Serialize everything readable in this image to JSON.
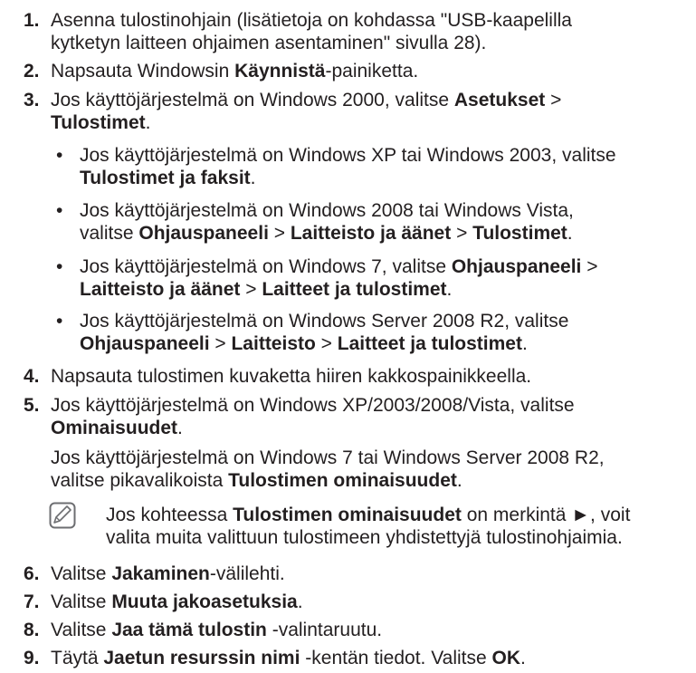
{
  "steps": [
    {
      "num": "1.",
      "l1": "Asenna tulostinohjain (lisätietoja on kohdassa \"USB-kaapelilla",
      "l2": "kytketyn laitteen ohjaimen asentaminen\" sivulla 28)."
    },
    {
      "num": "2.",
      "pre": "Napsauta Windowsin ",
      "b": "Käynnistä",
      "post": "-painiketta."
    },
    {
      "num": "3.",
      "pre": "Jos käyttöjärjestelmä on Windows 2000, valitse ",
      "b1": "Asetukset",
      "mid": " >",
      "b2": "Tulostimet",
      "post": "."
    },
    {
      "num": "4.",
      "text": "Napsauta tulostimen kuvaketta hiiren kakkospainikkeella."
    },
    {
      "num": "5.",
      "pre": "Jos käyttöjärjestelmä on Windows XP/2003/2008/Vista, valitse",
      "b": "Ominaisuudet",
      "post": "."
    },
    {
      "num": "6.",
      "pre": "Valitse ",
      "b": "Jakaminen",
      "post": "-välilehti."
    },
    {
      "num": "7.",
      "pre": "Valitse ",
      "b": "Muuta jakoasetuksia",
      "post": "."
    },
    {
      "num": "8.",
      "pre": "Valitse ",
      "b": "Jaa tämä tulostin",
      "post": " -valintaruutu."
    },
    {
      "num": "9.",
      "pre": "Täytä ",
      "b": "Jaetun resurssin nimi",
      "mid": " -kentän tiedot. Valitse ",
      "b2": "OK",
      "post": "."
    }
  ],
  "bullets": [
    {
      "dot": "•",
      "pre": "Jos käyttöjärjestelmä on Windows XP tai Windows 2003, valitse",
      "b1": "Tulostimet ja faksit",
      "post": "."
    },
    {
      "dot": "•",
      "pre": "Jos käyttöjärjestelmä on Windows 2008 tai Windows Vista,",
      "l2pre": "valitse ",
      "b1": "Ohjauspaneeli",
      "s1": " > ",
      "b2": "Laitteisto ja äänet",
      "s2": " > ",
      "b3": "Tulostimet",
      "post": "."
    },
    {
      "dot": "•",
      "pre": "Jos käyttöjärjestelmä on Windows 7, valitse ",
      "b1": "Ohjauspaneeli",
      "s1": " >",
      "b2": "Laitteisto ja äänet",
      "s2": " > ",
      "b3": "Laitteet ja tulostimet",
      "post": "."
    },
    {
      "dot": "•",
      "pre": "Jos käyttöjärjestelmä on Windows Server 2008 R2, valitse",
      "b1": "Ohjauspaneeli",
      "s1": " > ",
      "b2": "Laitteisto",
      "s2": " > ",
      "b3": "Laitteet ja tulostimet",
      "post": "."
    }
  ],
  "step5_extra": {
    "l1": "Jos käyttöjärjestelmä on Windows 7 tai Windows Server 2008 R2,",
    "pre": "valitse pikavalikoista ",
    "b": "Tulostimen ominaisuudet",
    "post": "."
  },
  "note": {
    "icon": "note-pencil-icon",
    "pre": "Jos kohteessa ",
    "b": "Tulostimen ominaisuudet",
    "post": " on merkintä ►, voit",
    "l2": "valita muita valittuun tulostimeen yhdistettyjä tulostinohjaimia."
  }
}
